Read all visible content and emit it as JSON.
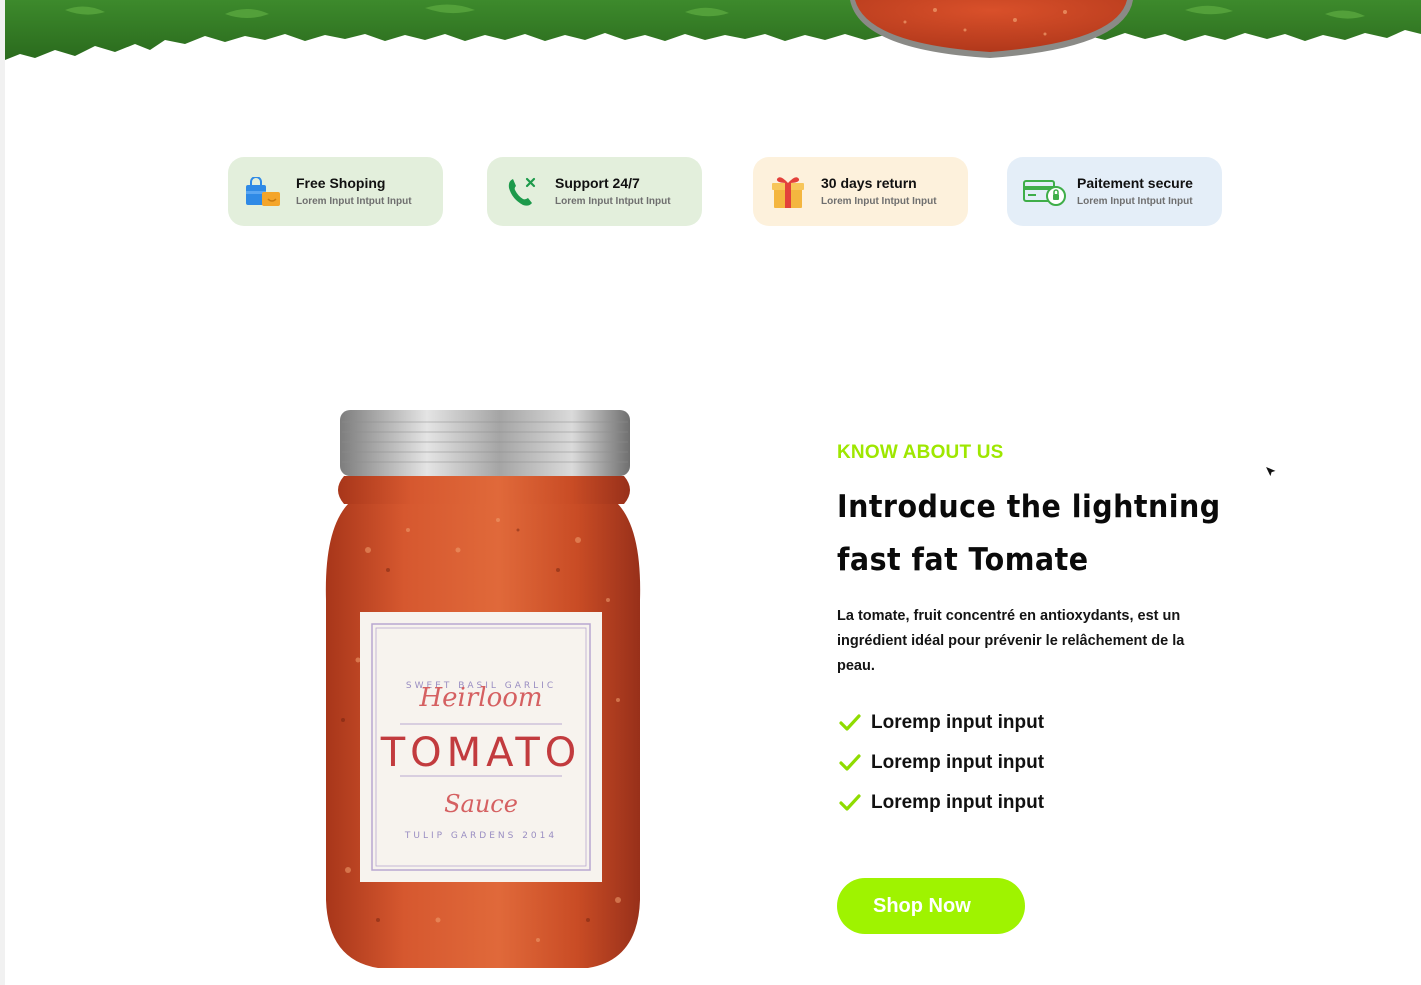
{
  "features": [
    {
      "title": "Free Shoping",
      "subtitle": "Lorem Input Intput Input",
      "icon": "shopping-bags-icon",
      "bg": "#e3efdc"
    },
    {
      "title": "Support 24/7",
      "subtitle": "Lorem Input Intput Input",
      "icon": "phone-support-icon",
      "bg": "#e3efdc"
    },
    {
      "title": "30 days return",
      "subtitle": "Lorem Input Intput Input",
      "icon": "gift-icon",
      "bg": "#fdf1dc"
    },
    {
      "title": "Paitement secure",
      "subtitle": "Lorem Input Intput Input",
      "icon": "secure-card-icon",
      "bg": "#e4eef8"
    }
  ],
  "product_image": {
    "label_top": "SWEET BASIL GARLIC",
    "label_script": "Heirloom",
    "label_main": "TOMATO",
    "label_script2": "Sauce",
    "label_bottom": "TULIP GARDENS 2014"
  },
  "about": {
    "eyebrow": "KNOW ABOUT US",
    "headline_line1": "Introduce the lightning",
    "headline_line2": "fast fat Tomate",
    "paragraph": "La tomate, fruit concentré en antioxydants, est un ingrédient idéal pour prévenir le relâchement de la peau.",
    "checklist": [
      "Loremp input input",
      "Loremp input input",
      "Loremp input input"
    ],
    "cta_label": "Shop Now"
  },
  "colors": {
    "accent": "#9ff300",
    "eyebrow": "#9ee700",
    "check": "#8fdc00"
  }
}
